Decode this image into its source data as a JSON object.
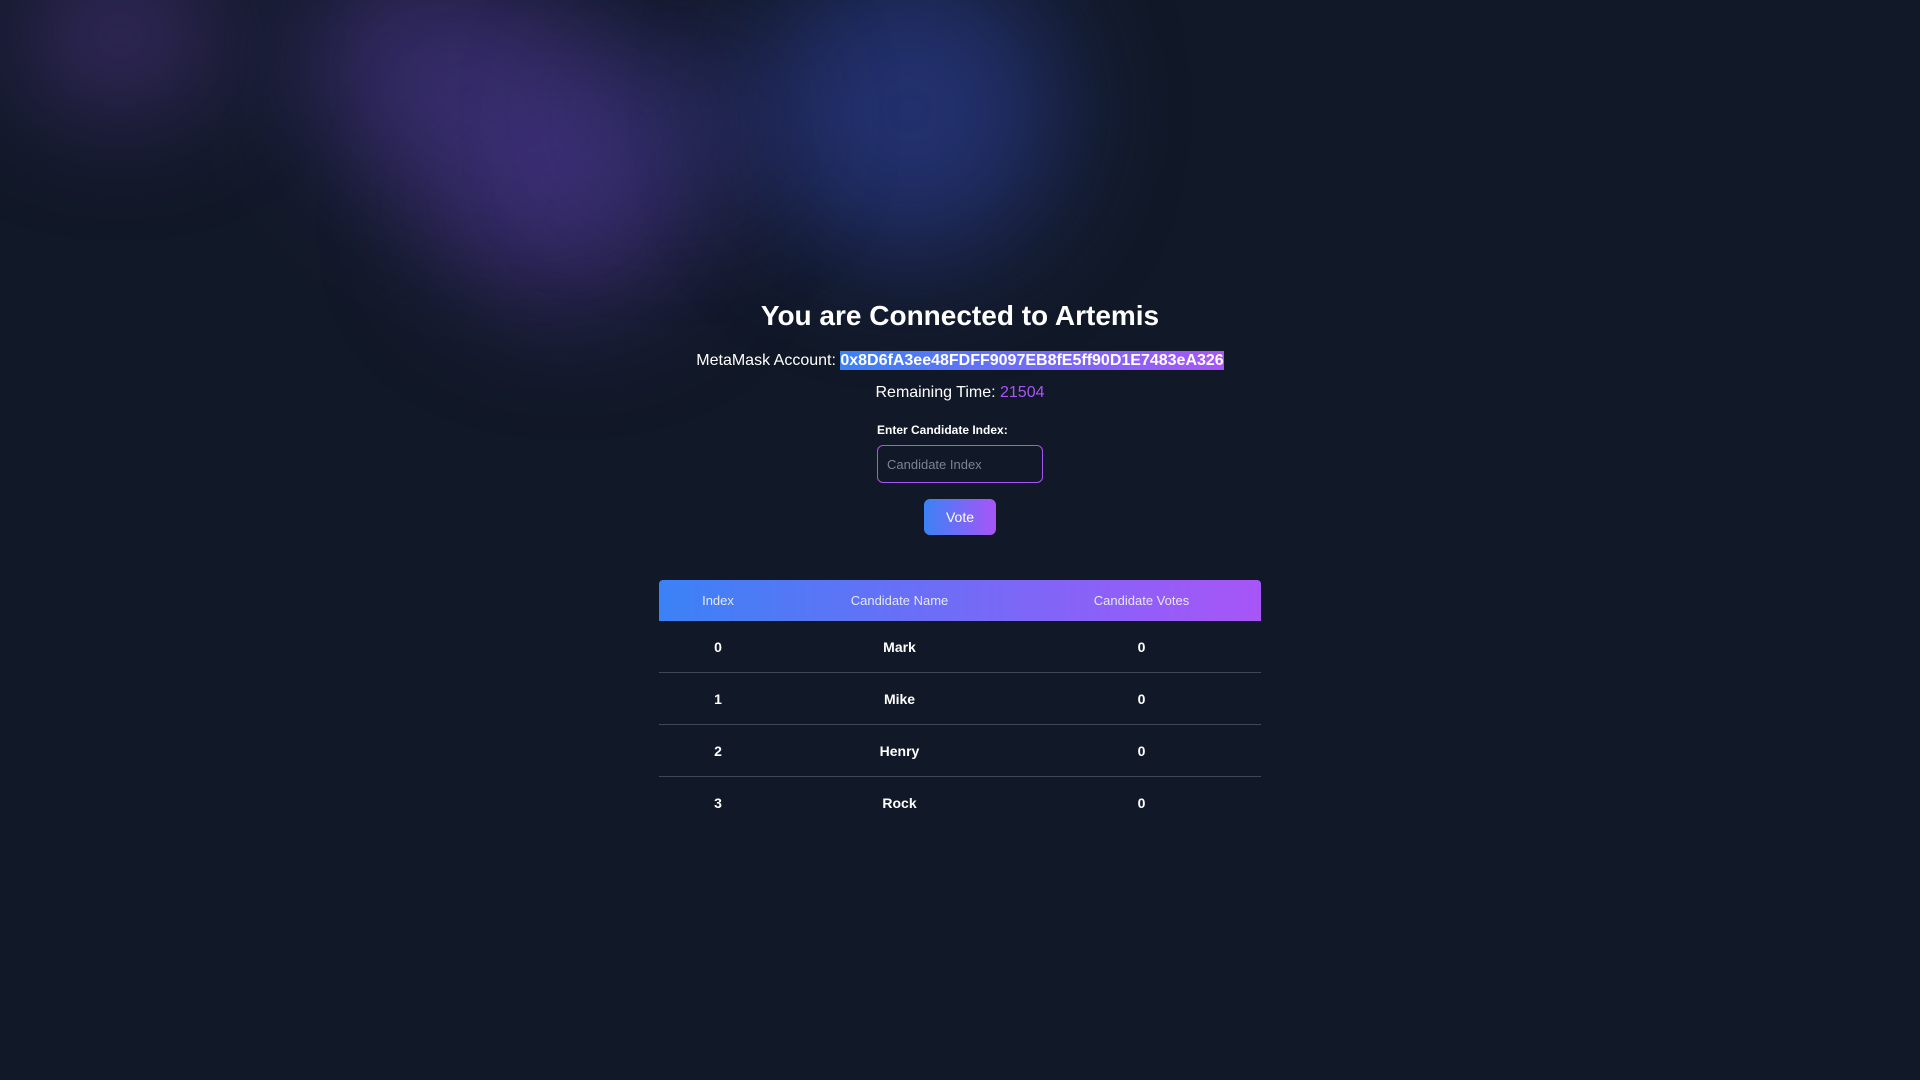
{
  "title": "You are Connected to Artemis",
  "account": {
    "label": "MetaMask Account:",
    "address": "0x8D6fA3ee48FDFF9097EB8fE5ff90D1E7483eA326"
  },
  "remaining": {
    "label": "Remaining Time:",
    "value": "21504"
  },
  "form": {
    "label": "Enter Candidate Index:",
    "placeholder": "Candidate Index",
    "value": "",
    "vote_label": "Vote"
  },
  "table": {
    "headers": [
      "Index",
      "Candidate Name",
      "Candidate Votes"
    ],
    "rows": [
      {
        "index": "0",
        "name": "Mark",
        "votes": "0"
      },
      {
        "index": "1",
        "name": "Mike",
        "votes": "0"
      },
      {
        "index": "2",
        "name": "Henry",
        "votes": "0"
      },
      {
        "index": "3",
        "name": "Rock",
        "votes": "0"
      }
    ]
  },
  "colors": {
    "background": "#111827",
    "accent_start": "#3b82f6",
    "accent_end": "#a855f7",
    "timer": "#a855f7"
  }
}
